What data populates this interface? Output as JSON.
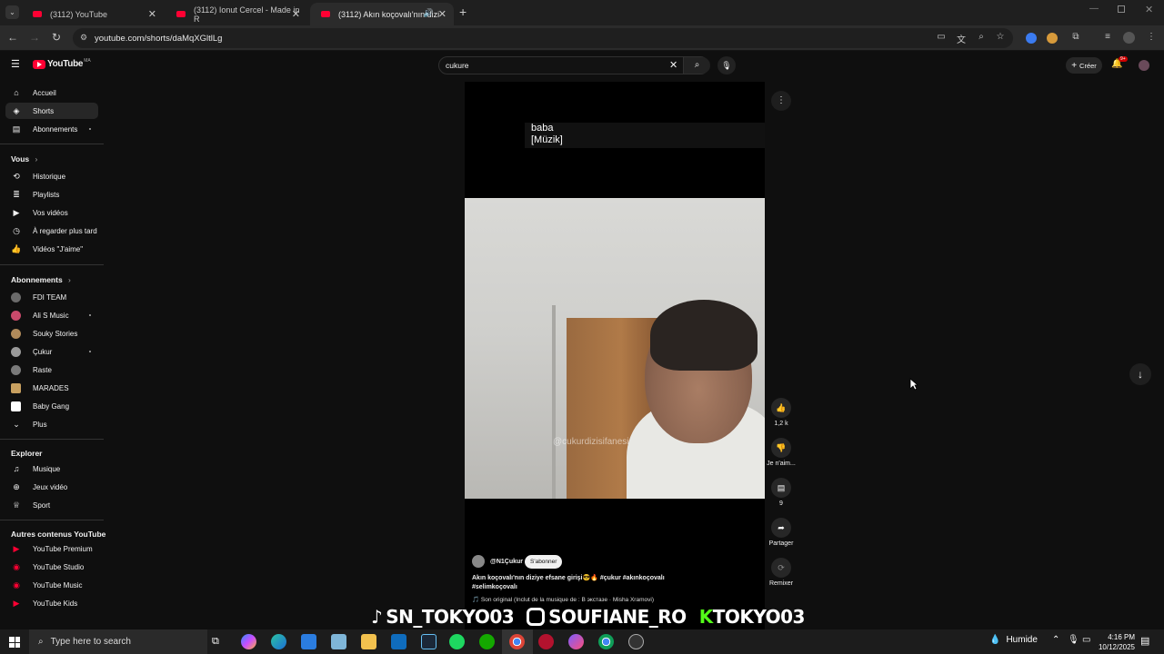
{
  "browser": {
    "tabs": [
      {
        "title": "(3112) YouTube"
      },
      {
        "title": "(3112) Ionut Cercel - Made in R"
      },
      {
        "title": "(3112) Akın koçovalı'nın dizi"
      }
    ],
    "url": "youtube.com/shorts/daMqXGltlLg"
  },
  "youtube": {
    "logo": "YouTube",
    "region": "MA",
    "search_value": "cukure",
    "create_label": "Créer",
    "notif_badge": "9+",
    "sidebar": {
      "main": [
        {
          "label": "Accueil",
          "icon": "home-icon"
        },
        {
          "label": "Shorts",
          "icon": "shorts-icon"
        },
        {
          "label": "Abonnements",
          "icon": "subscriptions-icon"
        }
      ],
      "you_header": "Vous",
      "you": [
        {
          "label": "Historique",
          "icon": "history-icon"
        },
        {
          "label": "Playlists",
          "icon": "playlist-icon"
        },
        {
          "label": "Vos vidéos",
          "icon": "your-videos-icon"
        },
        {
          "label": "À regarder plus tard",
          "icon": "watch-later-icon"
        },
        {
          "label": "Vidéos \"J'aime\"",
          "icon": "liked-icon"
        }
      ],
      "subs_header": "Abonnements",
      "subs": [
        {
          "label": "FDI TEAM",
          "color": "#6b6b6b"
        },
        {
          "label": "Ali S Music",
          "color": "#c94a6b"
        },
        {
          "label": "Souky Stories",
          "color": "#b08a5a"
        },
        {
          "label": "Çukur",
          "color": "#9a9a9a"
        },
        {
          "label": "Raste",
          "color": "#7a7a7a"
        },
        {
          "label": "MARADES",
          "color": "#c8a060"
        },
        {
          "label": "Baby Gang",
          "color": "#ffffff"
        },
        {
          "label": "Plus",
          "color": ""
        }
      ],
      "explore_header": "Explorer",
      "explore": [
        {
          "label": "Musique",
          "icon": "music-icon"
        },
        {
          "label": "Jeux vidéo",
          "icon": "gaming-icon"
        },
        {
          "label": "Sport",
          "icon": "trophy-icon"
        }
      ],
      "more_header": "Autres contenus YouTube",
      "more": [
        {
          "label": "YouTube Premium"
        },
        {
          "label": "YouTube Studio"
        },
        {
          "label": "YouTube Music"
        },
        {
          "label": "YouTube Kids"
        }
      ]
    },
    "short": {
      "caption_line1": "baba",
      "caption_line2": "[Müzik]",
      "watermark": "@cukurdizisifanesi",
      "channel": "@N1Çukur",
      "subscribe_label": "S'abonner",
      "title_line1": "Akın koçovalı'nın diziye efsane girişi😎🔥 #çukur #akınkoçovalı",
      "title_line2": "#selimkoçovalı",
      "sound": "🎵 Son original (Inclut de la musique de : В экстазе · Misha Xramovi)"
    },
    "actions": {
      "likes": "1,2 k",
      "dislike_label": "Je n'aim...",
      "comments": "9",
      "share_label": "Partager",
      "remix_label": "Remixer"
    }
  },
  "overlay": {
    "tiktok": "SN_TOKYO03",
    "instagram": "SOUFIANE_RO",
    "kick": "TOKYO03"
  },
  "taskbar": {
    "search_placeholder": "Type here to search",
    "weather": "Humide",
    "time": "4:16 PM",
    "date": "10/12/2025"
  }
}
